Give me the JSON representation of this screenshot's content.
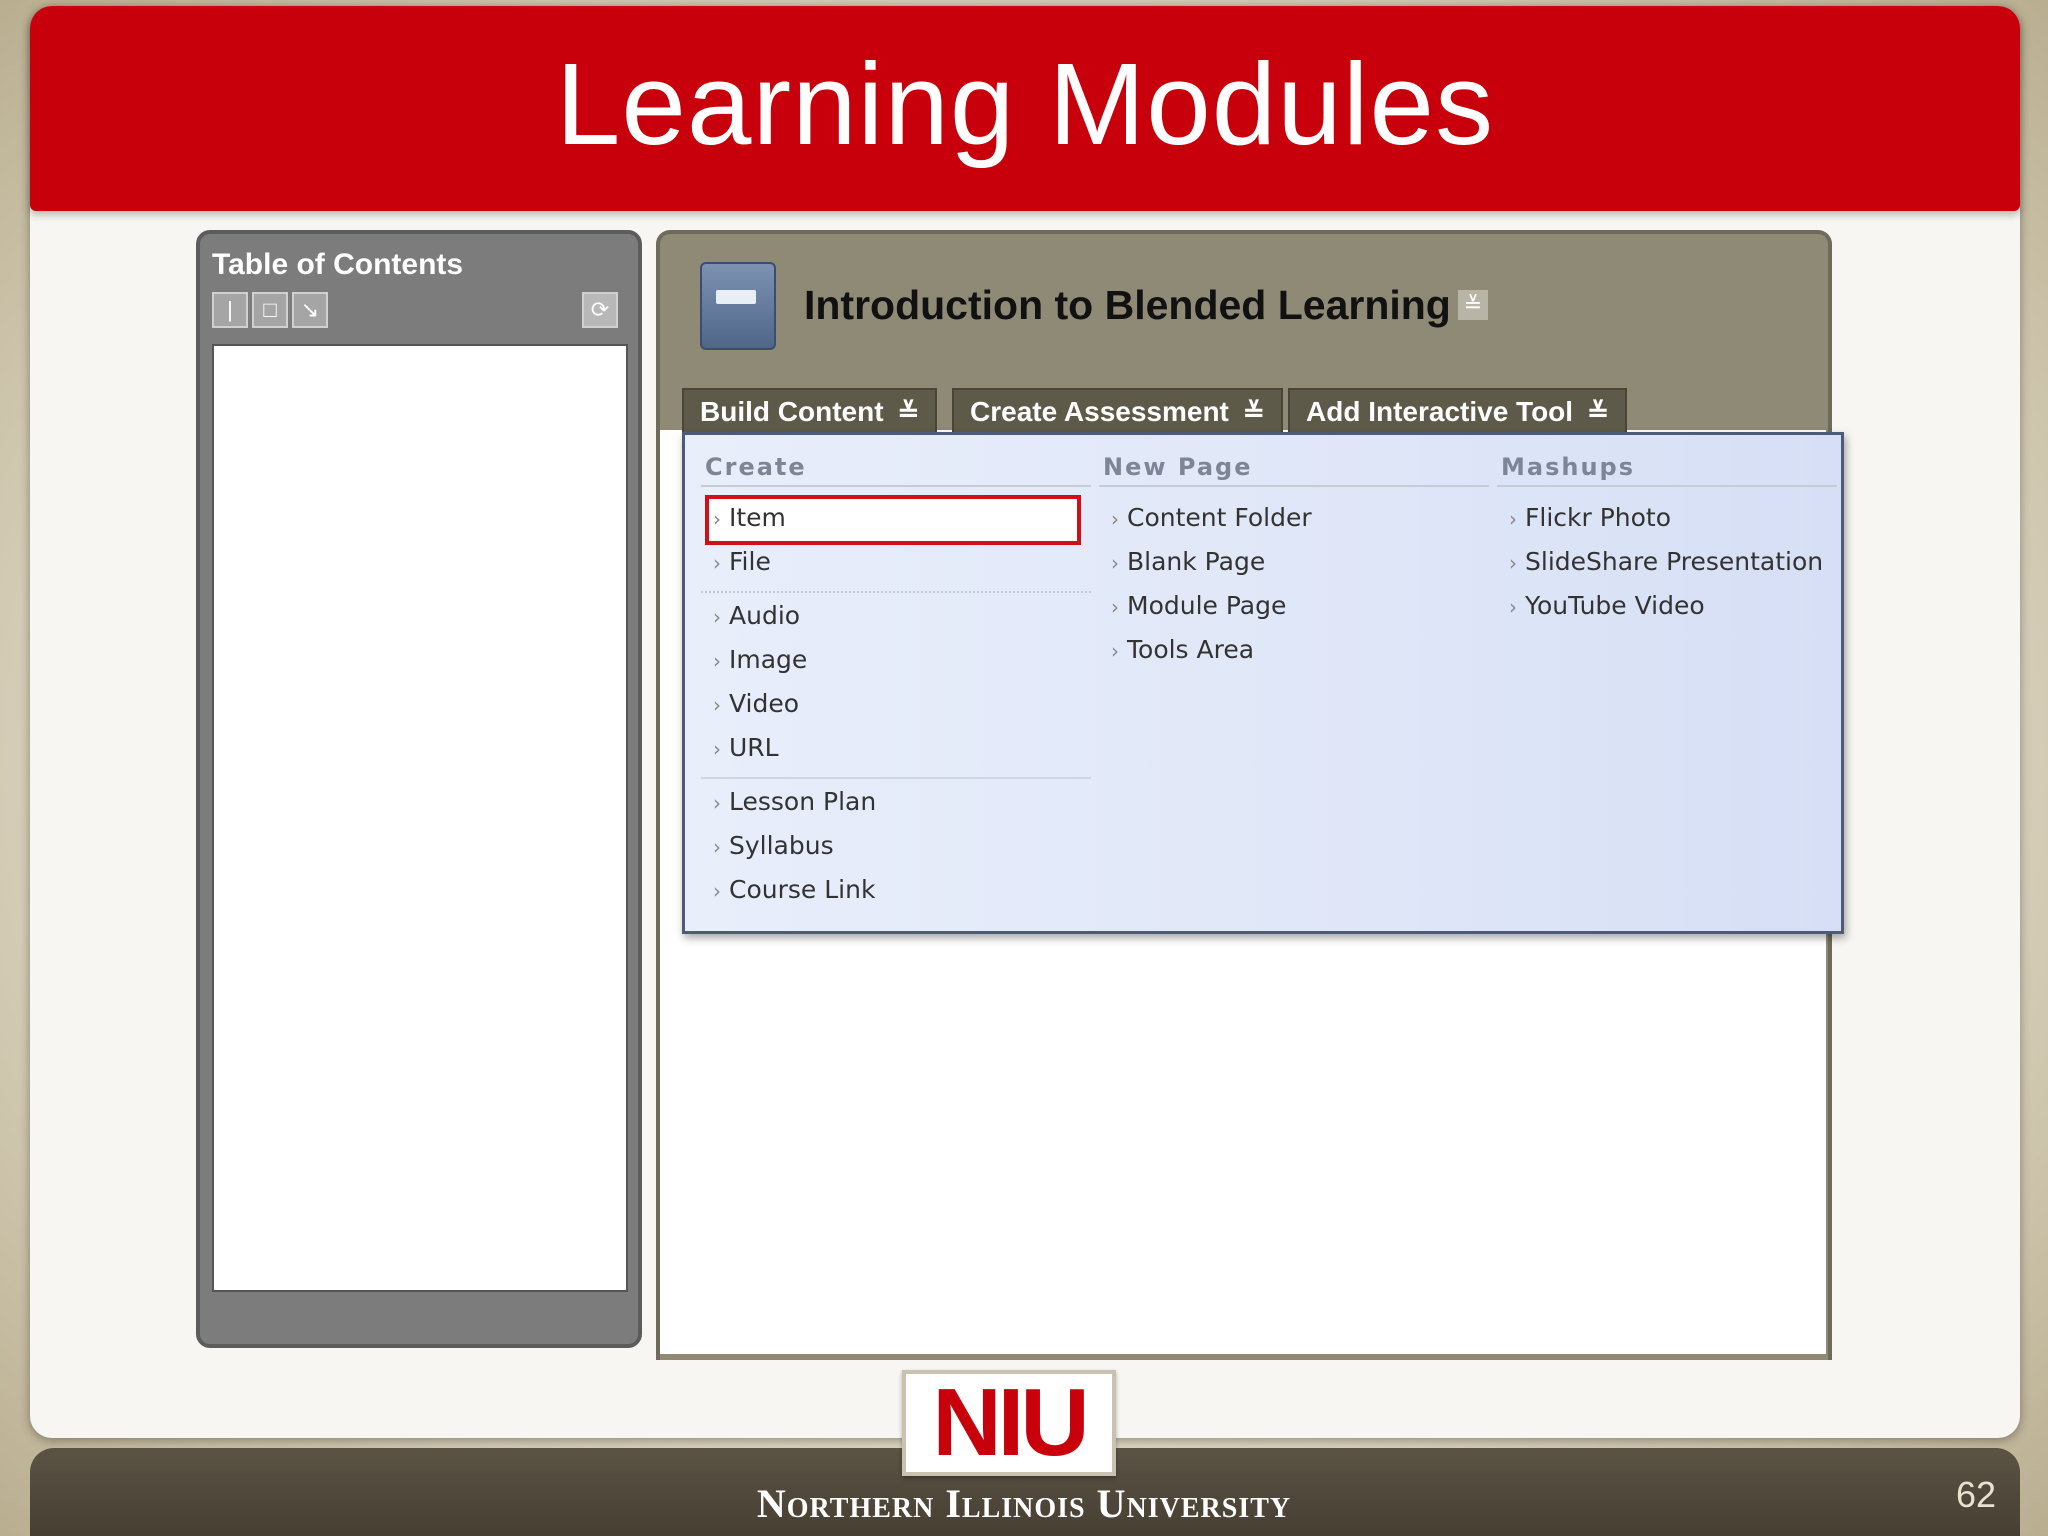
{
  "slide": {
    "title": "Learning Modules",
    "footer_text": "Northern Illinois University",
    "logo_text": "NIU",
    "page_number": "62"
  },
  "toc": {
    "title": "Table of Contents",
    "buttons": [
      {
        "icon": "expand-icon",
        "glyph": "|"
      },
      {
        "icon": "collapse-icon",
        "glyph": "□"
      },
      {
        "icon": "arrow-icon",
        "glyph": "↘"
      }
    ],
    "refresh_glyph": "⟳"
  },
  "content": {
    "course_title": "Introduction to Blended Learning",
    "course_chevron": "≚",
    "tabs": [
      {
        "label": "Build Content",
        "chevron": "≚"
      },
      {
        "label": "Create Assessment",
        "chevron": "≚"
      },
      {
        "label": "Add Interactive Tool",
        "chevron": "≚"
      }
    ]
  },
  "dropdown": {
    "create": {
      "header": "Create",
      "items": [
        "Item",
        "File",
        "Audio",
        "Image",
        "Video",
        "URL",
        "Lesson Plan",
        "Syllabus",
        "Course Link"
      ]
    },
    "new_page": {
      "header": "New Page",
      "items": [
        "Content Folder",
        "Blank Page",
        "Module Page",
        "Tools Area"
      ]
    },
    "mashups": {
      "header": "Mashups",
      "items": [
        "Flickr Photo",
        "SlideShare Presentation",
        "YouTube Video"
      ]
    },
    "arrow_glyph": "›"
  },
  "colors": {
    "title_red": "#c8000b",
    "footer_brown": "#4a4236",
    "highlight_red": "#d01018"
  }
}
